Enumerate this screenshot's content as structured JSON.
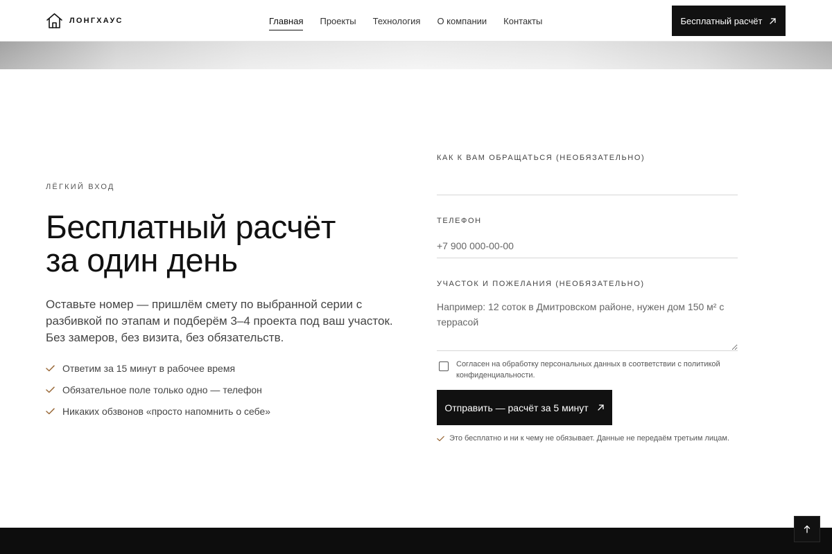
{
  "header": {
    "logo_text": "ЛОНГХАУС",
    "nav": [
      {
        "label": "Главная",
        "active": true
      },
      {
        "label": "Проекты",
        "active": false
      },
      {
        "label": "Технология",
        "active": false
      },
      {
        "label": "О компании",
        "active": false
      },
      {
        "label": "Контакты",
        "active": false
      }
    ],
    "cta_label": "Бесплатный расчёт"
  },
  "intro": {
    "eyebrow": "ЛЁГКИЙ ВХОД",
    "headline_line1": "Бесплатный расчёт",
    "headline_line2": "за один день",
    "lead": "Оставьте номер — пришлём смету по выбранной серии с разбивкой по этапам и подберём 3–4 проекта под ваш участок. Без замеров, без визита, без обязательств.",
    "benefits": [
      "Ответим за 15 минут в рабочее время",
      "Обязательное поле только одно — телефон",
      "Никаких обзвонов «просто напомнить о себе»"
    ]
  },
  "form": {
    "name_label": "КАК К ВАМ ОБРАЩАТЬСЯ (НЕОБЯЗАТЕЛЬНО)",
    "name_value": "",
    "name_placeholder": "",
    "phone_label": "ТЕЛЕФОН",
    "phone_placeholder": "+7 900 000-00-00",
    "details_label": "УЧАСТОК И ПОЖЕЛАНИЯ (НЕОБЯЗАТЕЛЬНО)",
    "details_placeholder": "Например: 12 соток в Дмитровском районе, нужен дом 150 м² с террасой",
    "consent_text": "Согласен на обработку персональных данных в соответствии с политикой конфиденциальности.",
    "consent_checked": false,
    "submit_label": "Отправить — расчёт за 5 минут",
    "note": "Это бесплатно и ни к чему не обязывает. Данные не передаём третьим лицам."
  },
  "icons": {
    "logo": "house-icon",
    "cta_arrow": "arrow-up-right-icon",
    "benefit_check": "check-icon",
    "scroll_top": "arrow-up-icon"
  },
  "colors": {
    "ink": "#111111",
    "background": "#ffffff",
    "accent_check": "#9a6a3a",
    "muted_text": "#444444",
    "footer": "#0d0d0d"
  }
}
